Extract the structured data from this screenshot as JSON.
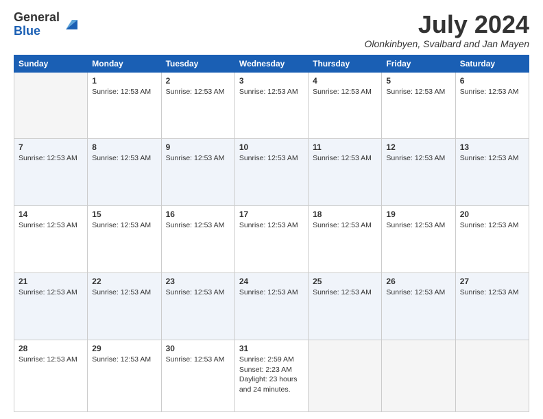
{
  "header": {
    "logo_general": "General",
    "logo_blue": "Blue",
    "month_title": "July 2024",
    "location": "Olonkinbyen, Svalbard and Jan Mayen"
  },
  "weekdays": [
    "Sunday",
    "Monday",
    "Tuesday",
    "Wednesday",
    "Thursday",
    "Friday",
    "Saturday"
  ],
  "weeks": [
    [
      {
        "day": "",
        "info": ""
      },
      {
        "day": "1",
        "info": "Sunrise: 12:53 AM"
      },
      {
        "day": "2",
        "info": "Sunrise: 12:53 AM"
      },
      {
        "day": "3",
        "info": "Sunrise: 12:53 AM"
      },
      {
        "day": "4",
        "info": "Sunrise: 12:53 AM"
      },
      {
        "day": "5",
        "info": "Sunrise: 12:53 AM"
      },
      {
        "day": "6",
        "info": "Sunrise: 12:53 AM"
      }
    ],
    [
      {
        "day": "7",
        "info": "Sunrise: 12:53 AM"
      },
      {
        "day": "8",
        "info": "Sunrise: 12:53 AM"
      },
      {
        "day": "9",
        "info": "Sunrise: 12:53 AM"
      },
      {
        "day": "10",
        "info": "Sunrise: 12:53 AM"
      },
      {
        "day": "11",
        "info": "Sunrise: 12:53 AM"
      },
      {
        "day": "12",
        "info": "Sunrise: 12:53 AM"
      },
      {
        "day": "13",
        "info": "Sunrise: 12:53 AM"
      }
    ],
    [
      {
        "day": "14",
        "info": "Sunrise: 12:53 AM"
      },
      {
        "day": "15",
        "info": "Sunrise: 12:53 AM"
      },
      {
        "day": "16",
        "info": "Sunrise: 12:53 AM"
      },
      {
        "day": "17",
        "info": "Sunrise: 12:53 AM"
      },
      {
        "day": "18",
        "info": "Sunrise: 12:53 AM"
      },
      {
        "day": "19",
        "info": "Sunrise: 12:53 AM"
      },
      {
        "day": "20",
        "info": "Sunrise: 12:53 AM"
      }
    ],
    [
      {
        "day": "21",
        "info": "Sunrise: 12:53 AM"
      },
      {
        "day": "22",
        "info": "Sunrise: 12:53 AM"
      },
      {
        "day": "23",
        "info": "Sunrise: 12:53 AM"
      },
      {
        "day": "24",
        "info": "Sunrise: 12:53 AM"
      },
      {
        "day": "25",
        "info": "Sunrise: 12:53 AM"
      },
      {
        "day": "26",
        "info": "Sunrise: 12:53 AM"
      },
      {
        "day": "27",
        "info": "Sunrise: 12:53 AM"
      }
    ],
    [
      {
        "day": "28",
        "info": "Sunrise: 12:53 AM"
      },
      {
        "day": "29",
        "info": "Sunrise: 12:53 AM"
      },
      {
        "day": "30",
        "info": "Sunrise: 12:53 AM"
      },
      {
        "day": "31",
        "info": "Sunrise: 2:59 AM\nSunset: 2:23 AM\nDaylight: 23 hours and 24 minutes."
      },
      {
        "day": "",
        "info": ""
      },
      {
        "day": "",
        "info": ""
      },
      {
        "day": "",
        "info": ""
      }
    ]
  ]
}
